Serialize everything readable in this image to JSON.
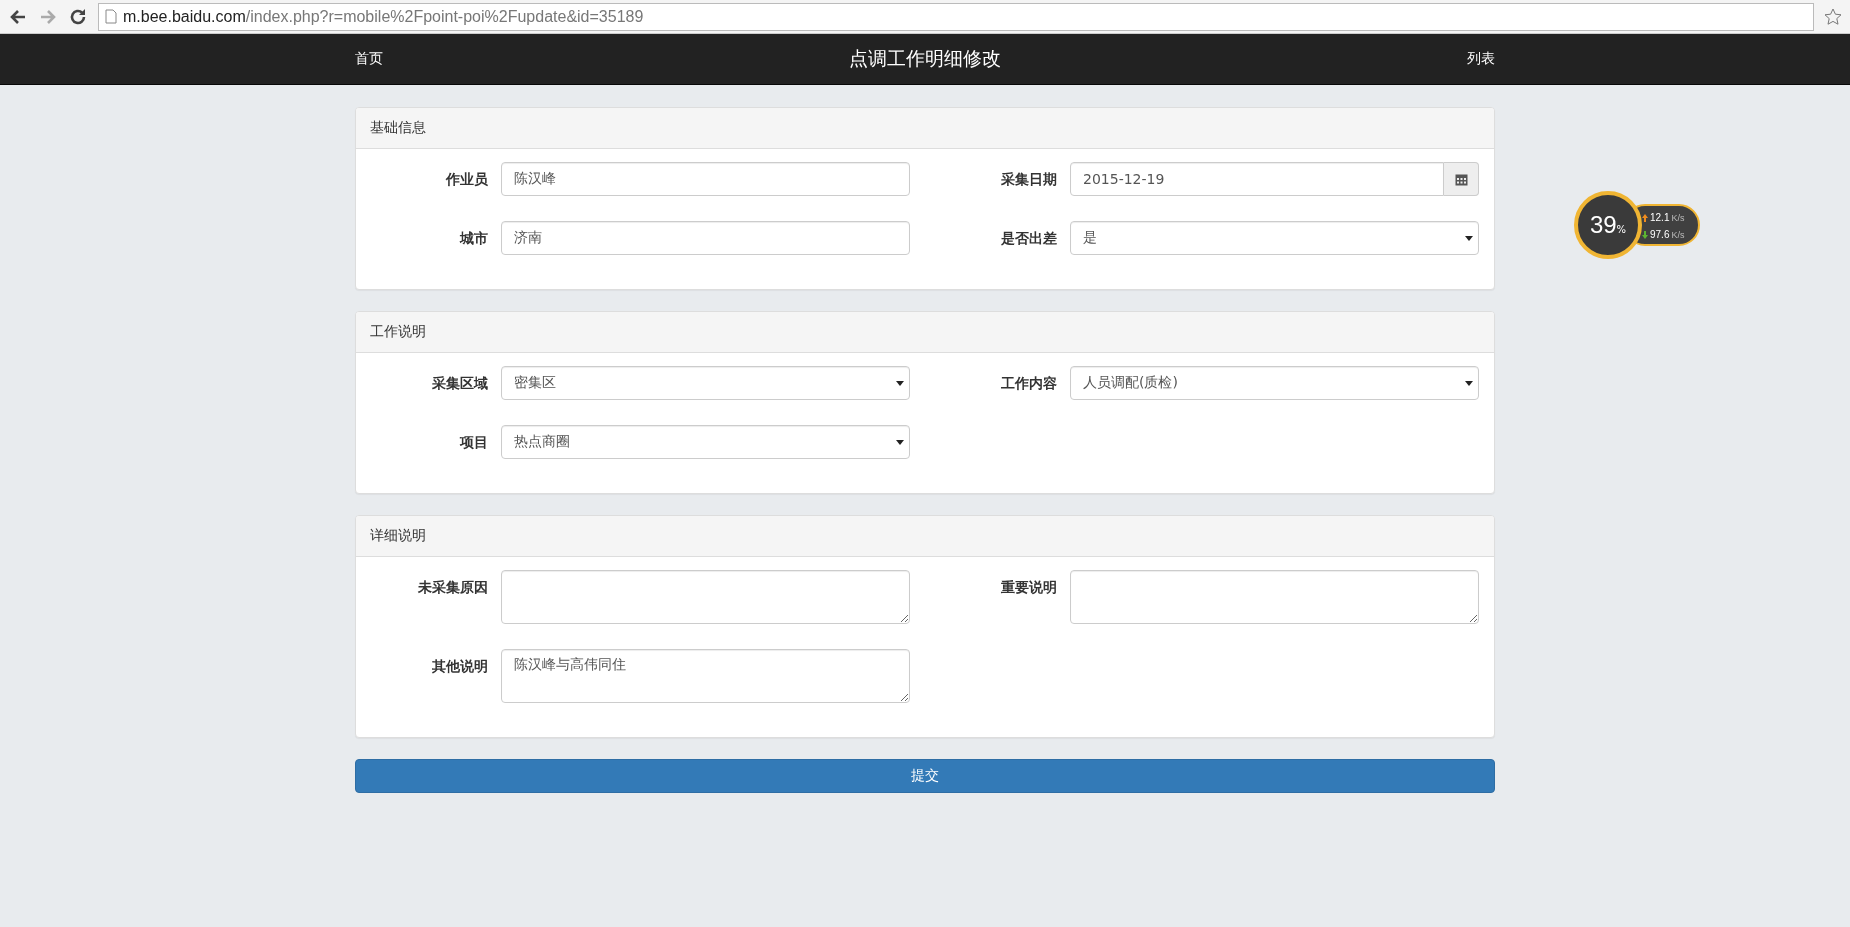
{
  "browser": {
    "url_host": "m.bee.baidu.com",
    "url_path": "/index.php?r=mobile%2Fpoint-poi%2Fupdate&id=35189"
  },
  "navbar": {
    "home": "首页",
    "title": "点调工作明细修改",
    "list": "列表"
  },
  "panels": [
    {
      "title": "基础信息",
      "fields": [
        {
          "label": "作业员",
          "kind": "text",
          "value": "陈汉峰"
        },
        {
          "label": "采集日期",
          "kind": "date",
          "value": "2015-12-19"
        },
        {
          "label": "城市",
          "kind": "text",
          "value": "济南"
        },
        {
          "label": "是否出差",
          "kind": "select",
          "value": "是"
        }
      ]
    },
    {
      "title": "工作说明",
      "fields": [
        {
          "label": "采集区域",
          "kind": "select",
          "value": "密集区"
        },
        {
          "label": "工作内容",
          "kind": "select",
          "value": "人员调配(质检)"
        },
        {
          "label": "项目",
          "kind": "select",
          "value": "热点商圈"
        }
      ]
    },
    {
      "title": "详细说明",
      "fields": [
        {
          "label": "未采集原因",
          "kind": "textarea"
        },
        {
          "label": "重要说明",
          "kind": "textarea"
        },
        {
          "label": "其他说明",
          "kind": "textarea",
          "value": "陈汉峰与高伟同住"
        }
      ]
    }
  ],
  "submit": "提交",
  "widget": {
    "percent": "39",
    "percent_unit": "%",
    "upload": "12.1",
    "upload_unit": "K/s",
    "download": "97.6",
    "download_unit": "K/s"
  }
}
